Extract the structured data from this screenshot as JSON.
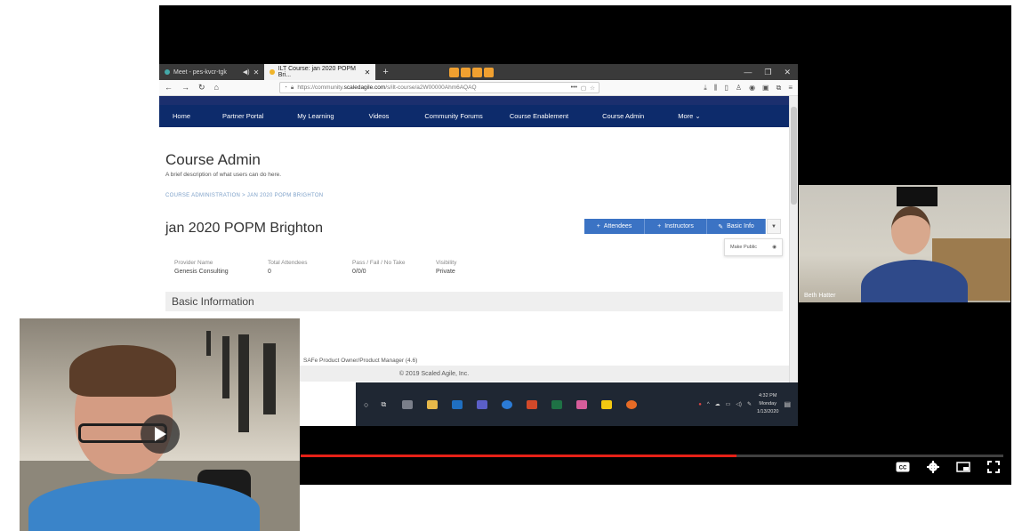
{
  "browser": {
    "tabs": [
      {
        "label": "Meet - pes-kvcr-tgk"
      },
      {
        "label": "ILT Course: jan 2020 POPM Bri..."
      }
    ],
    "url_prefix": "https://community.",
    "url_domain": "scaledagile.com",
    "url_rest": "/s/ilt-course/a2W00000Ahm6AQAQ"
  },
  "site": {
    "nav": [
      "Home",
      "Partner Portal",
      "My Learning",
      "Videos",
      "Community Forums",
      "Course Enablement",
      "Course Admin",
      "More"
    ]
  },
  "page": {
    "title": "Course Admin",
    "description": "A brief description of what users can do here.",
    "breadcrumb": "COURSE ADMINISTRATION > JAN 2020 POPM BRIGHTON",
    "course_title": "jan 2020 POPM Brighton",
    "buttons": {
      "attendees": "Attendees",
      "instructors": "Instructors",
      "basic_info": "Basic Info"
    },
    "menu_item": "Make Public",
    "stats": [
      {
        "label": "Provider Name",
        "value": "Genesis Consulting"
      },
      {
        "label": "Total Attendees",
        "value": "0"
      },
      {
        "label": "Pass / Fail / No Take",
        "value": "0/0/0"
      },
      {
        "label": "Visibility",
        "value": "Private"
      }
    ],
    "section_title": "Basic Information",
    "course_product": "SAFe Product Owner/Product Manager (4.6)",
    "footer": "© 2019 Scaled Agile, Inc."
  },
  "taskbar": {
    "time": "4:32 PM",
    "day": "Monday",
    "date": "1/13/2020"
  },
  "participant": {
    "name": "Beth Hatter"
  },
  "player": {
    "progress": 0.62
  },
  "colors": {
    "site_nav": "#0d2b6b",
    "button": "#3b73c4",
    "progress": "#e62117"
  }
}
